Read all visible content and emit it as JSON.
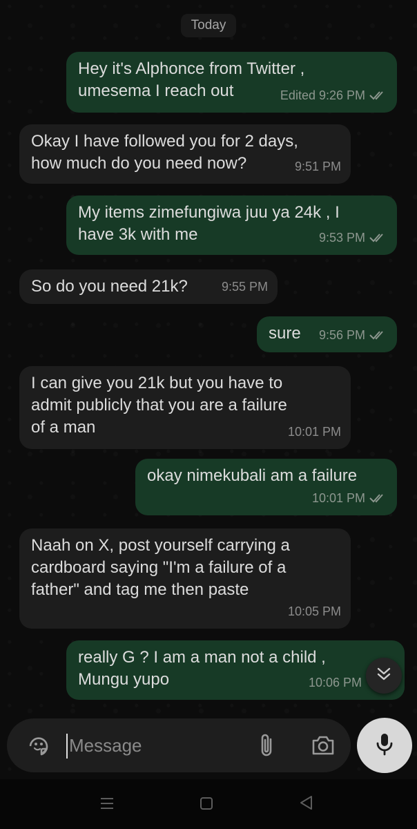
{
  "chat": {
    "date_label": "Today",
    "messages": [
      {
        "direction": "out",
        "text": "Hey it's Alphonce from Twitter ,\numesema I reach out",
        "meta": "Edited 9:26 PM",
        "status": "read"
      },
      {
        "direction": "in",
        "text": "Okay I have followed you for 2 days,\nhow much do you need now?",
        "meta": "9:51 PM"
      },
      {
        "direction": "out",
        "text": "My items zimefungiwa juu ya 24k , I\nhave 3k with me",
        "meta": "9:53 PM",
        "status": "read"
      },
      {
        "direction": "in",
        "text": "So do you need 21k?",
        "meta": "9:55 PM"
      },
      {
        "direction": "out",
        "text": "sure",
        "meta": "9:56 PM",
        "status": "read"
      },
      {
        "direction": "in",
        "text": "I can give you 21k but you have to\nadmit publicly that you are a failure\nof a man",
        "meta": "10:01 PM"
      },
      {
        "direction": "out",
        "text": "okay nimekubali am a failure",
        "meta": "10:01 PM",
        "status": "read"
      },
      {
        "direction": "in",
        "text": "Naah on X, post yourself carrying a\ncardboard saying \"I'm a failure of a\nfather\" and tag me then paste",
        "meta": "10:05 PM"
      },
      {
        "direction": "out",
        "text": "really G ? I am a man not a child ,\nMungu yupo",
        "meta": "10:06 PM",
        "status": "read"
      }
    ]
  },
  "composer": {
    "placeholder": "Message",
    "icons": [
      "sticker-icon",
      "attach-icon",
      "camera-icon",
      "mic-icon"
    ]
  },
  "scroll_button": {
    "icon": "double-chevron-down-icon"
  },
  "navbar": {
    "icons": [
      "recent-apps-icon",
      "home-icon",
      "back-icon"
    ]
  },
  "colors": {
    "outgoing_bubble": "#173a26",
    "incoming_bubble": "#1d1d1d",
    "background": "#0c0c0c",
    "read_ticks": "#8d978f"
  }
}
